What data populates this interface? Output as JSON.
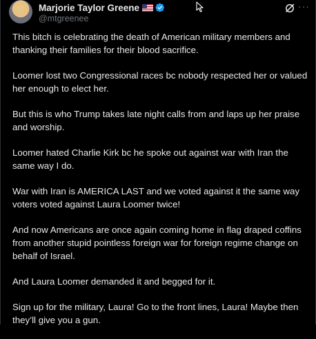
{
  "tweet": {
    "display_name": "Marjorie Taylor Greene",
    "handle": "@mtgreenee",
    "icons": [
      "flag-us-icon",
      "verified-badge-icon",
      "grok-icon",
      "more-options-icon",
      "mouse-cursor-icon"
    ],
    "colors": {
      "background": "#000000",
      "text": "#e7e9ea",
      "secondary_text": "#71767b",
      "verified_blue": "#1d9bf0"
    },
    "paragraphs": [
      "This bitch is celebrating the death of American military members and thanking their families for their blood sacrifice.",
      "Loomer lost two Congressional races bc nobody respected her or valued her enough to elect her.",
      "But this is who Trump takes late night calls from and laps up her praise and worship.",
      "Loomer hated Charlie Kirk bc he spoke out against war with Iran the same way I do.",
      "War with Iran is AMERICA LAST and we voted against it the same way voters voted against Laura Loomer twice!",
      "And now Americans are once again coming home in flag draped coffins from another stupid pointless foreign war for foreign regime change on behalf of Israel.",
      "And Laura Loomer demanded it and begged for it.",
      "Sign up for the military, Laura! Go to the front lines, Laura! Maybe then they’ll give you a gun."
    ],
    "more_label": "···"
  }
}
